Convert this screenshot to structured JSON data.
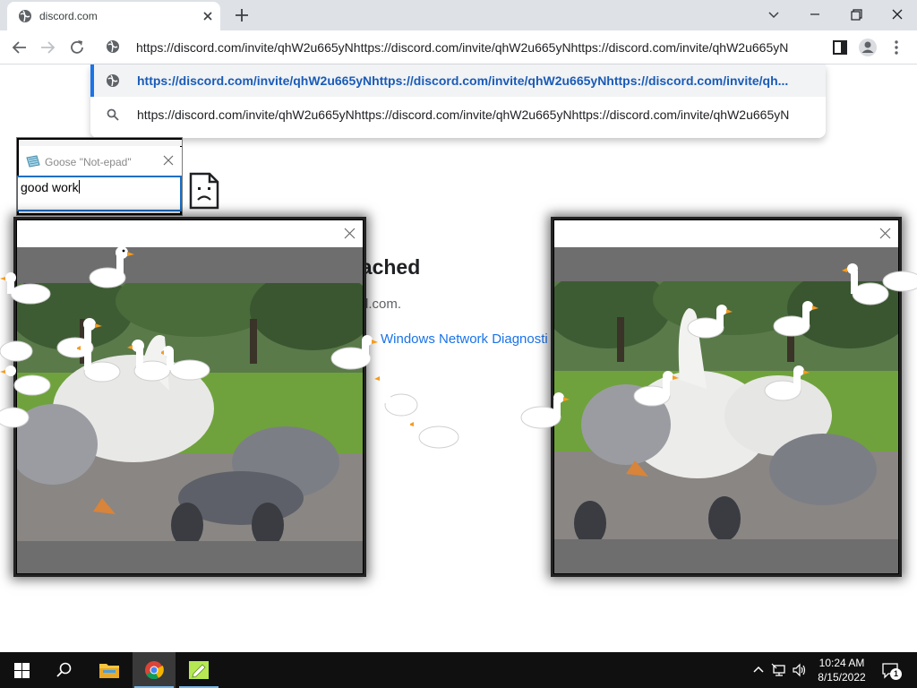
{
  "browser": {
    "tab_title": "discord.com",
    "omnibox_text": "https://discord.com/invite/qhW2u665yNhttps://discord.com/invite/qhW2u665yNhttps://discord.com/invite/qhW2u665yN",
    "suggestions": [
      {
        "text": "https://discord.com/invite/qhW2u665yNhttps://discord.com/invite/qhW2u665yNhttps://discord.com/invite/qh...",
        "icon": "globe-icon"
      },
      {
        "text": "https://discord.com/invite/qhW2u665yNhttps://discord.com/invite/qhW2u665yNhttps://discord.com/invite/qhW2u665yN",
        "icon": "search-icon"
      }
    ]
  },
  "error_page": {
    "heading_fragment": "eached",
    "sub_fragment": "rd.com.",
    "link_fragment": "Windows Network Diagnosti"
  },
  "notepad": {
    "title": "Goose \"Not-epad\"",
    "text": "good work"
  },
  "taskbar": {
    "time": "10:24 AM",
    "date": "8/15/2022",
    "notification_count": "1",
    "apps": [
      "start-icon",
      "search-icon",
      "file-explorer-icon",
      "chrome-icon",
      "notepad-icon"
    ]
  },
  "colors": {
    "accent": "#1a73e8",
    "taskbar": "#101010",
    "tabstrip": "#dee1e6"
  }
}
